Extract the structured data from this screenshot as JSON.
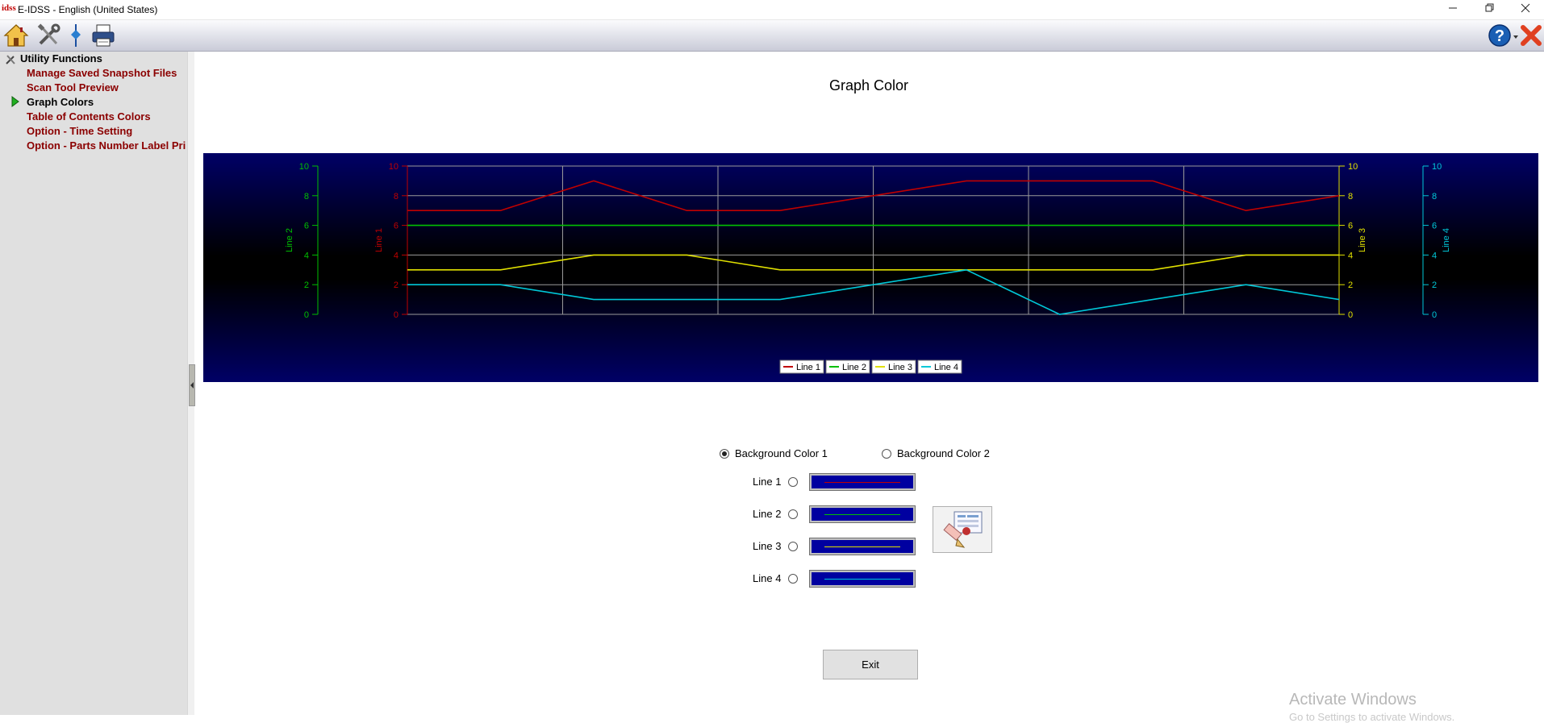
{
  "window": {
    "logo_text": "idss",
    "title": "E-IDSS - English (United States)",
    "controls": [
      "minimize",
      "restore",
      "close"
    ]
  },
  "toolbar": {
    "buttons": [
      "home-icon",
      "tools-icon",
      "signal-icon",
      "printer-icon"
    ],
    "right_buttons": [
      "help-icon",
      "exit-icon"
    ]
  },
  "sidebar": {
    "header": "Utility Functions",
    "items": [
      {
        "label": "Manage Saved Snapshot Files",
        "active": false
      },
      {
        "label": "Scan Tool Preview",
        "active": false
      },
      {
        "label": "Graph Colors",
        "active": true
      },
      {
        "label": "Table of Contents Colors",
        "active": false
      },
      {
        "label": "Option - Time Setting",
        "active": false
      },
      {
        "label": "Option - Parts Number Label Printing",
        "active": false
      }
    ]
  },
  "main": {
    "title": "Graph Color",
    "background_options": [
      {
        "label": "Background Color 1",
        "checked": true
      },
      {
        "label": "Background Color 2",
        "checked": false
      }
    ],
    "lines": [
      {
        "label": "Line 1",
        "color": "#c00000"
      },
      {
        "label": "Line 2",
        "color": "#00c000"
      },
      {
        "label": "Line 3",
        "color": "#e0e000"
      },
      {
        "label": "Line 4",
        "color": "#00c8d8"
      }
    ],
    "exit_label": "Exit"
  },
  "chart_data": {
    "type": "line",
    "x": [
      0,
      1,
      2,
      3,
      4,
      5,
      6,
      7,
      8,
      9,
      10
    ],
    "series": [
      {
        "name": "Line 1",
        "color": "#c00000",
        "axis": "Line 1",
        "values": [
          7,
          7,
          9,
          7,
          7,
          8,
          9,
          9,
          9,
          7,
          8
        ]
      },
      {
        "name": "Line 2",
        "color": "#00c000",
        "axis": "Line 2",
        "values": [
          6,
          6,
          6,
          6,
          6,
          6,
          6,
          6,
          6,
          6,
          6
        ]
      },
      {
        "name": "Line 3",
        "color": "#e0e000",
        "axis": "Line 3",
        "values": [
          3,
          3,
          4,
          4,
          3,
          3,
          3,
          3,
          3,
          4,
          4
        ]
      },
      {
        "name": "Line 4",
        "color": "#00c8d8",
        "axis": "Line 4",
        "values": [
          2,
          2,
          1,
          1,
          1,
          2,
          3,
          0,
          1,
          2,
          1
        ]
      }
    ],
    "axes": [
      {
        "label": "Line 2",
        "color": "#00c000",
        "ylim": [
          0,
          10
        ]
      },
      {
        "label": "Line 1",
        "color": "#c00000",
        "ylim": [
          0,
          10
        ]
      },
      {
        "label": "Line 3",
        "color": "#e0e000",
        "ylim": [
          0,
          10
        ]
      },
      {
        "label": "Line 4",
        "color": "#00c8d8",
        "ylim": [
          0,
          10
        ]
      }
    ],
    "yticks": [
      0,
      2,
      4,
      6,
      8,
      10
    ],
    "grid": true,
    "legend": "bottom-center",
    "background": "gradient navy-black-navy"
  },
  "watermark": {
    "line1": "Activate Windows",
    "line2": "Go to Settings to activate Windows."
  }
}
